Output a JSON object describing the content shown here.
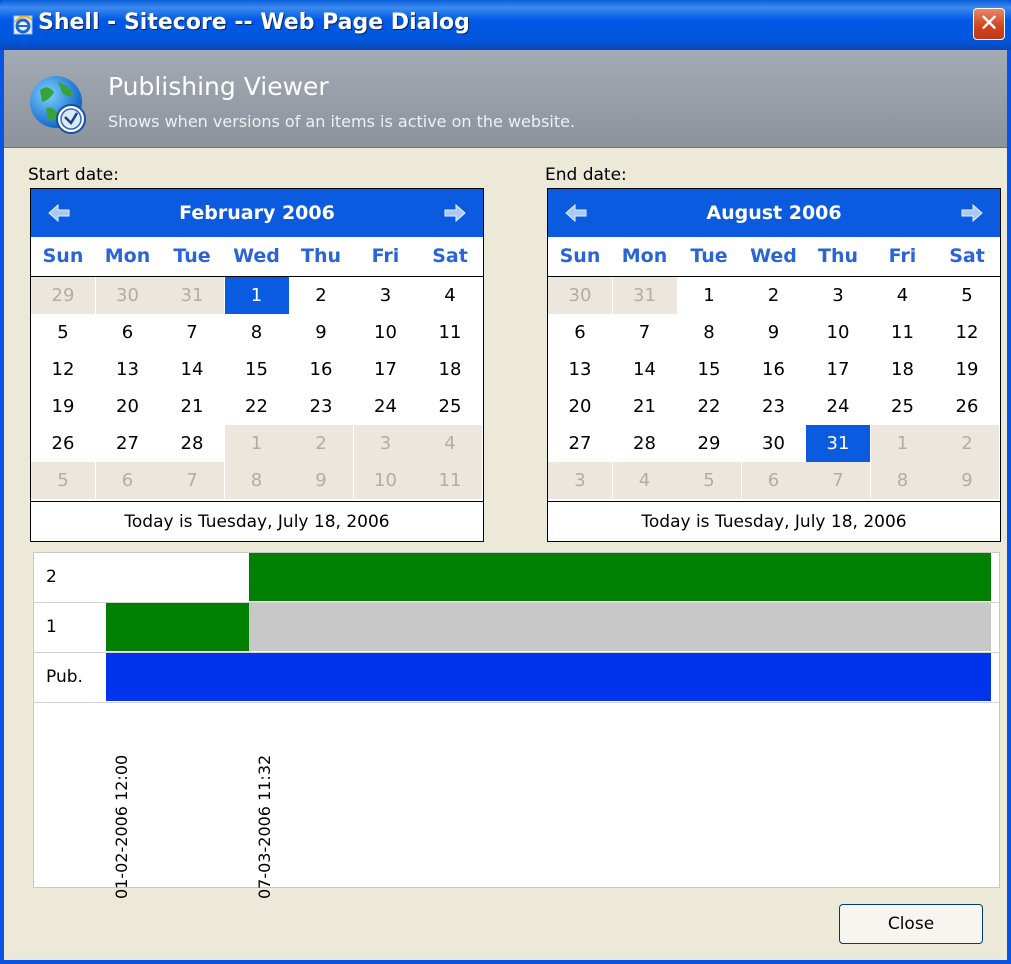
{
  "window": {
    "title": "Shell - Sitecore -- Web Page Dialog",
    "close_glyph": "✕"
  },
  "header": {
    "title": "Publishing Viewer",
    "subtitle": "Shows when versions of an items is active on the website."
  },
  "start_calendar": {
    "label": "Start date:",
    "month_title": "February 2006",
    "weekdays": [
      "Sun",
      "Mon",
      "Tue",
      "Wed",
      "Thu",
      "Fri",
      "Sat"
    ],
    "weeks": [
      [
        "29",
        "30",
        "31",
        "1",
        "2",
        "3",
        "4"
      ],
      [
        "5",
        "6",
        "7",
        "8",
        "9",
        "10",
        "11"
      ],
      [
        "12",
        "13",
        "14",
        "15",
        "16",
        "17",
        "18"
      ],
      [
        "19",
        "20",
        "21",
        "22",
        "23",
        "24",
        "25"
      ],
      [
        "26",
        "27",
        "28",
        "1",
        "2",
        "3",
        "4"
      ],
      [
        "5",
        "6",
        "7",
        "8",
        "9",
        "10",
        "11"
      ]
    ],
    "selected_day": "1",
    "today_text": "Today is Tuesday, July 18, 2006"
  },
  "end_calendar": {
    "label": "End date:",
    "month_title": "August 2006",
    "weekdays": [
      "Sun",
      "Mon",
      "Tue",
      "Wed",
      "Thu",
      "Fri",
      "Sat"
    ],
    "weeks": [
      [
        "30",
        "31",
        "1",
        "2",
        "3",
        "4",
        "5"
      ],
      [
        "6",
        "7",
        "8",
        "9",
        "10",
        "11",
        "12"
      ],
      [
        "13",
        "14",
        "15",
        "16",
        "17",
        "18",
        "19"
      ],
      [
        "20",
        "21",
        "22",
        "23",
        "24",
        "25",
        "26"
      ],
      [
        "27",
        "28",
        "29",
        "30",
        "31",
        "1",
        "2"
      ],
      [
        "3",
        "4",
        "5",
        "6",
        "7",
        "8",
        "9"
      ]
    ],
    "selected_day": "31",
    "today_text": "Today is Tuesday, July 18, 2006"
  },
  "timeline": {
    "rows": [
      {
        "label": "2",
        "segments": [
          {
            "state": "active",
            "color": "#008000",
            "from_marker": 1,
            "to_marker": "end"
          }
        ]
      },
      {
        "label": "1",
        "segments": [
          {
            "state": "active",
            "color": "#008000",
            "from_marker": 0,
            "to_marker": 1
          },
          {
            "state": "inactive",
            "color": "#c8c8c8",
            "from_marker": 1,
            "to_marker": "end"
          }
        ]
      },
      {
        "label": "Pub.",
        "segments": [
          {
            "state": "published",
            "color": "#0033ee",
            "from_marker": 0,
            "to_marker": "end"
          }
        ]
      }
    ],
    "markers": [
      "01-02-2006 12:00",
      "07-03-2006 11:32"
    ]
  },
  "buttons": {
    "close_label": "Close"
  },
  "colors": {
    "title_bar": "#0058e6",
    "calendar_header": "#0b5be1",
    "active_version": "#008000",
    "inactive_version": "#c8c8c8",
    "published": "#0033ee"
  }
}
